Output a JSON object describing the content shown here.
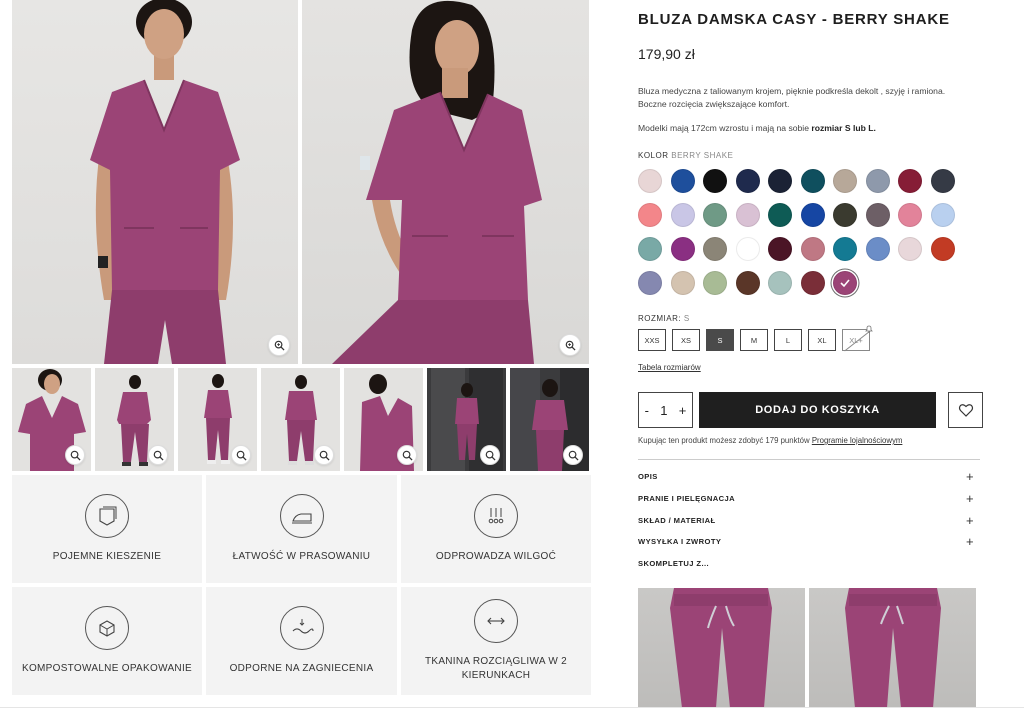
{
  "product": {
    "title": "BLUZA DAMSKA CASY - BERRY SHAKE",
    "price": "179,90 zł",
    "description_line1": "Bluza medyczna z taliowanym krojem, pięknie podkreśla dekolt , szyję i ramiona.",
    "description_line2": "Boczne rozcięcia zwiększające komfort.",
    "models_prefix": "Modelki mają 172cm wzrostu i mają na sobie ",
    "models_bold": "rozmiar S lub L."
  },
  "color": {
    "label": "KOLOR",
    "selected_name": "BERRY SHAKE",
    "swatches": [
      "#e8d6d6",
      "#1e4f9c",
      "#111111",
      "#1f2a4d",
      "#1b2235",
      "#0f4f5e",
      "#b7a899",
      "#8e99ab",
      "#861d36",
      "#353a45",
      "#f3868a",
      "#c9c6e6",
      "#6f9a86",
      "#d9c1d4",
      "#0e5b55",
      "#1646a3",
      "#3a3a2f",
      "#6d5f66",
      "#e2839a",
      "#b9d0ef",
      "#79a9a6",
      "#8a2f82",
      "#8b8577",
      "#ffffff",
      "#4b1526",
      "#bf7884",
      "#147a93",
      "#6b8dc7",
      "#e8d7da",
      "#c23b24",
      "#8588b0",
      "#d4c3b0",
      "#a8bb95",
      "#5a3628",
      "#a6c2bd",
      "#7a2e38",
      "#9b4476"
    ]
  },
  "size": {
    "label": "ROZMIAR:",
    "selected": "S",
    "options": [
      "XXS",
      "XS",
      "S",
      "M",
      "L",
      "XL",
      "XL+"
    ],
    "table_link": "Tabela rozmiarów"
  },
  "cart": {
    "minus": "-",
    "qty": "1",
    "plus": "+",
    "add_label": "DODAJ DO KOSZYKA"
  },
  "loyalty": {
    "text": "Kupując ten produkt możesz zdobyć 179 punktów ",
    "link": "Programie lojalnościowym"
  },
  "accordion": [
    {
      "label": "OPIS",
      "icon": "+"
    },
    {
      "label": "PRANIE I PIELĘGNACJA",
      "icon": "+"
    },
    {
      "label": "SKŁAD / MATERIAŁ",
      "icon": "+"
    },
    {
      "label": "WYSYŁKA I ZWROTY",
      "icon": "+"
    },
    {
      "label": "SKOMPLETUJ Z...",
      "icon": ""
    }
  ],
  "features": [
    {
      "label": "POJEMNE KIESZENIE",
      "icon": "pocket-icon"
    },
    {
      "label": "ŁATWOŚĆ W PRASOWANIU",
      "icon": "iron-icon"
    },
    {
      "label": "ODPROWADZA WILGOĆ",
      "icon": "moisture-icon"
    },
    {
      "label": "KOMPOSTOWALNE OPAKOWANIE",
      "icon": "compostable-package-icon"
    },
    {
      "label": "ODPORNE NA ZAGNIECENIA",
      "icon": "wrinkle-resistant-icon"
    },
    {
      "label": "TKANINA ROZCIĄGLIWA W 2 KIERUNKACH",
      "icon": "two-way-stretch-icon"
    }
  ],
  "colors": {
    "garment": "#9b4476",
    "garment_dark": "#7f355f",
    "skin": "#c99a7b",
    "hair": "#1c1512",
    "cta": "#1f1f1f"
  }
}
